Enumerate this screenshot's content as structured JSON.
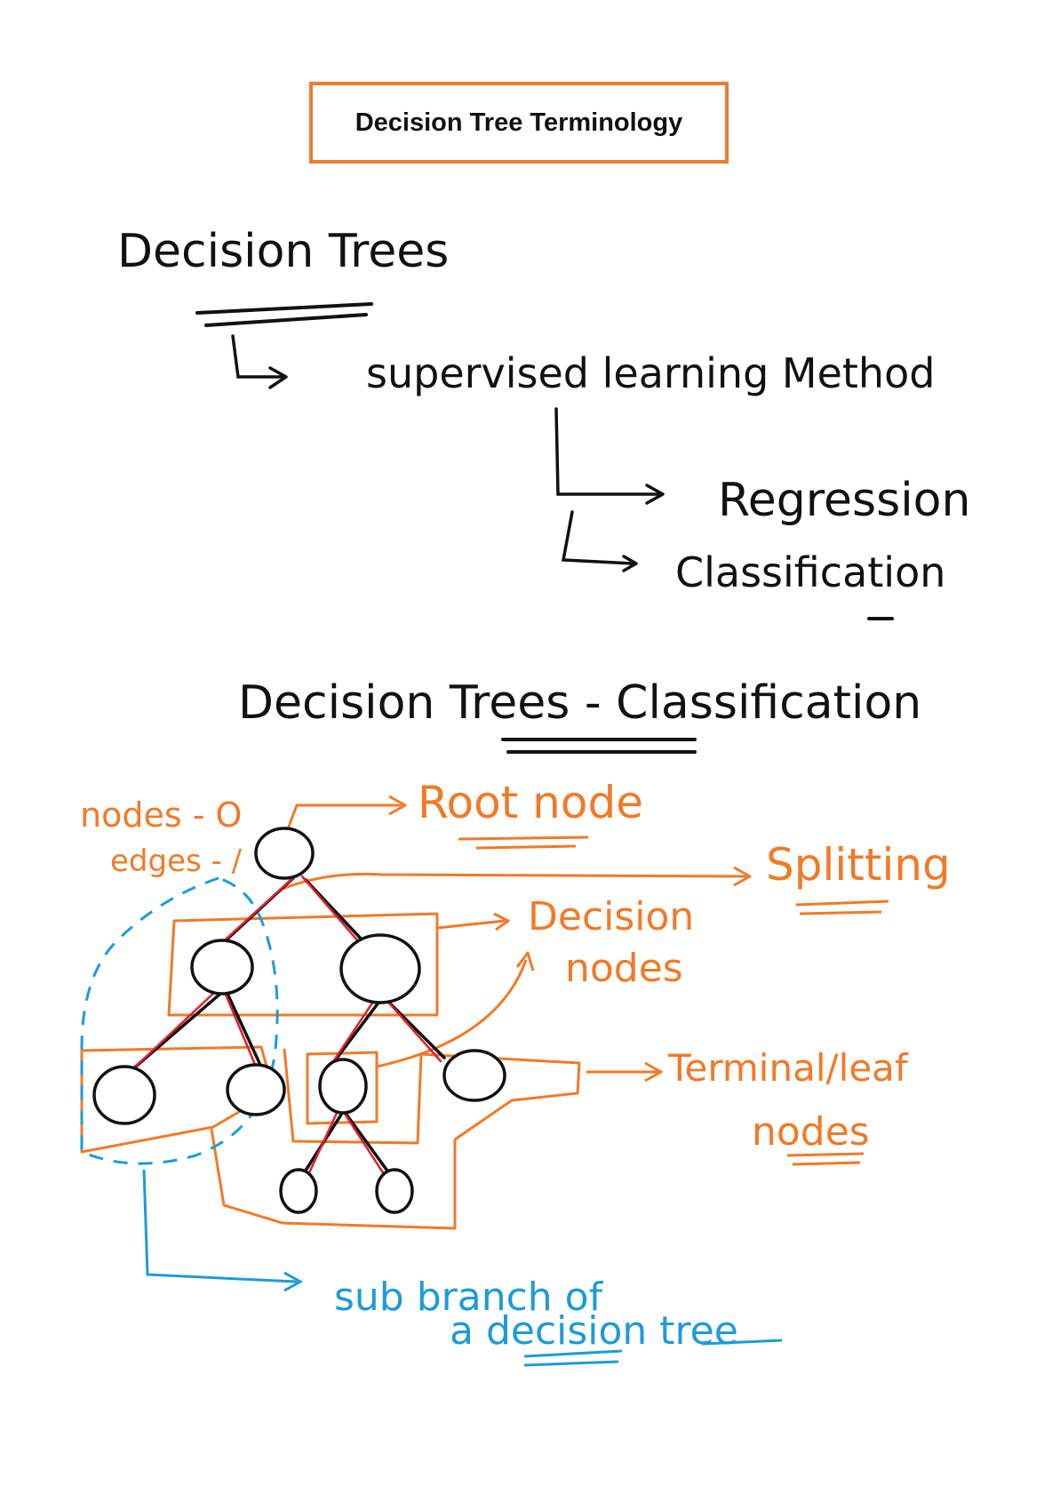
{
  "title": "Decision Tree Terminology",
  "notes": {
    "heading1": "Decision Trees",
    "supervised": "supervised learning Method",
    "regression": "Regression",
    "classification": "Classification",
    "heading2": "Decision Trees - Classification"
  },
  "labels": {
    "nodes": "nodes - O",
    "edges": "edges - /",
    "root_node": "Root node",
    "splitting": "Splitting",
    "decision": "Decision",
    "decision_nodes": "nodes",
    "terminal_leaf": "Terminal/leaf",
    "terminal_nodes": "nodes",
    "sub_branch": "sub branch of",
    "a_decision_tree": "a decision tree"
  },
  "colors": {
    "ink": "#111111",
    "accent": "#ED7D31",
    "orange_ink": "#F07A28",
    "blue_ink": "#1E9BD7",
    "edge_red": "#E0202A"
  }
}
